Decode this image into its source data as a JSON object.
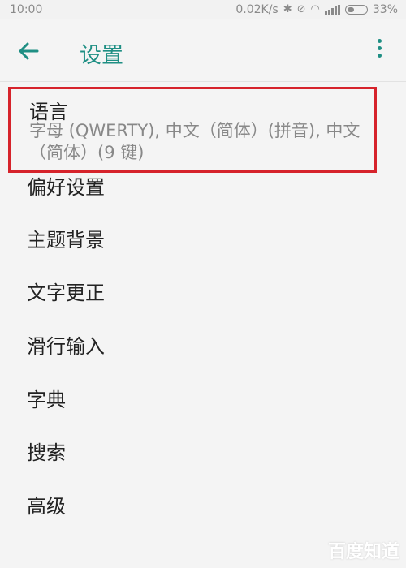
{
  "status_bar": {
    "time": "10:00",
    "speed": "0.02K/s",
    "battery": "33%",
    "icons": [
      "bluetooth-icon",
      "alarm-off-icon",
      "wifi-icon",
      "signal-icon",
      "battery-icon"
    ]
  },
  "app_bar": {
    "title": "设置",
    "back_icon": "arrow-left-icon",
    "more_icon": "more-vertical-icon"
  },
  "colors": {
    "accent": "#1f8f84",
    "highlight_border": "#d6232b"
  },
  "settings": {
    "language": {
      "title": "语言",
      "subtitle": "字母 (QWERTY), 中文（简体）(拼音), 中文（简体）(9 键)"
    },
    "items": [
      {
        "label": "偏好设置"
      },
      {
        "label": "主题背景"
      },
      {
        "label": "文字更正"
      },
      {
        "label": "滑行输入"
      },
      {
        "label": "字典"
      },
      {
        "label": "搜索"
      },
      {
        "label": "高级"
      }
    ]
  },
  "watermark": "百度知道"
}
